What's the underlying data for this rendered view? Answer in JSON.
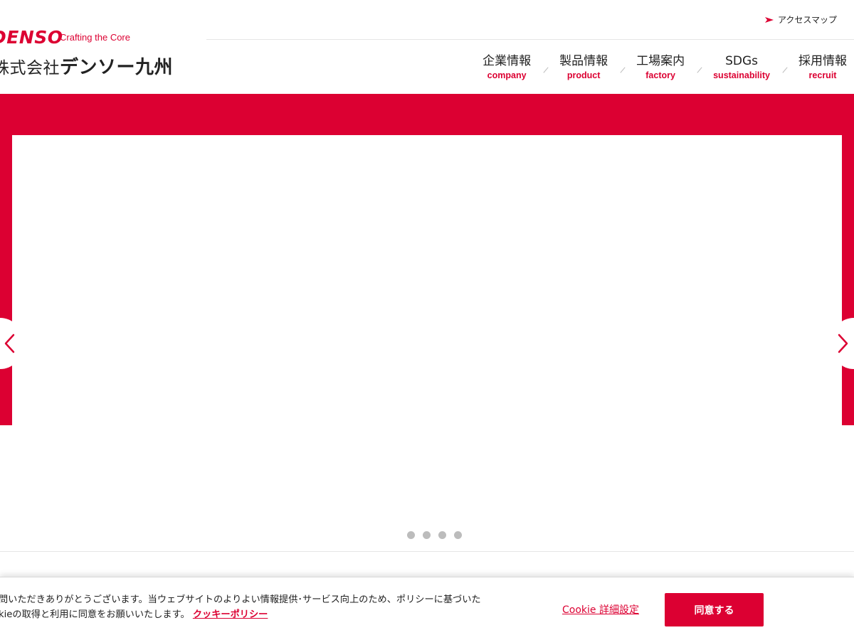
{
  "brand": {
    "logo_text": "DENSO",
    "tagline": "Crafting the Core",
    "company_prefix": "株式会社",
    "company_name": "デンソー九州",
    "accent_color": "#dc0032"
  },
  "header": {
    "access_map_label": "アクセスマップ",
    "access_map_icon": "arrow-right-icon"
  },
  "nav": {
    "items": [
      {
        "ja": "企業情報",
        "en": "company"
      },
      {
        "ja": "製品情報",
        "en": "product"
      },
      {
        "ja": "工場案内",
        "en": "factory"
      },
      {
        "ja": "SDGs",
        "en": "sustainability"
      },
      {
        "ja": "採用情報",
        "en": "recruit"
      }
    ]
  },
  "carousel": {
    "prev_icon": "chevron-left-icon",
    "next_icon": "chevron-right-icon",
    "slide_count": 4
  },
  "cookie_banner": {
    "line1": "問いただきありがとうございます。当ウェブサイトのよりよい情報提供･サービス向上のため、ポリシーに基づいた",
    "line2": "kieの取得と利用に同意をお願いいたします。",
    "policy_link": "クッキーポリシー",
    "settings_label": "Cookie 詳細設定",
    "agree_label": "同意する"
  }
}
